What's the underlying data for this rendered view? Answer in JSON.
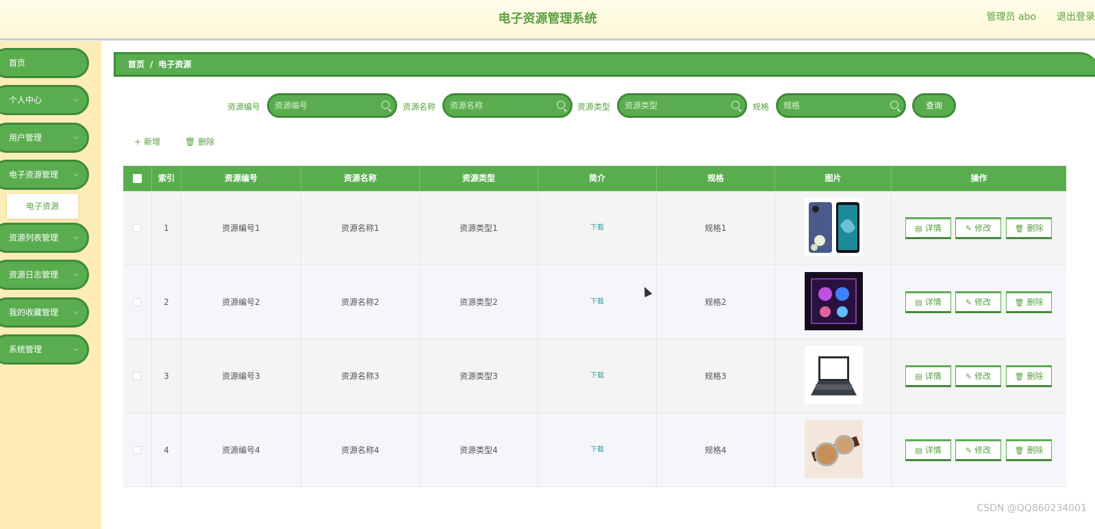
{
  "header": {
    "title": "电子资源管理系统",
    "user": "管理员 abo",
    "logout": "退出登录"
  },
  "sidebar": {
    "items": [
      {
        "label": "首页",
        "has_chevron": false
      },
      {
        "label": "个人中心",
        "has_chevron": true
      },
      {
        "label": "用户管理",
        "has_chevron": true
      },
      {
        "label": "电子资源管理",
        "has_chevron": true
      },
      {
        "label": "资源列表管理",
        "has_chevron": true
      },
      {
        "label": "资源日志管理",
        "has_chevron": true
      },
      {
        "label": "我的收藏管理",
        "has_chevron": true
      },
      {
        "label": "系统管理",
        "has_chevron": true
      }
    ],
    "sub_item": "电子资源",
    "chevron": "⌵"
  },
  "breadcrumb": {
    "home": "首页",
    "sep": "/",
    "current": "电子资源"
  },
  "search": {
    "fields": [
      {
        "label": "资源编号",
        "placeholder": "资源编号"
      },
      {
        "label": "资源名称",
        "placeholder": "资源名称"
      },
      {
        "label": "资源类型",
        "placeholder": "资源类型"
      },
      {
        "label": "规格",
        "placeholder": "规格"
      }
    ],
    "query_label": "查询"
  },
  "toolbar": {
    "add_label": "新增",
    "delete_label": "删除",
    "add_icon": "+",
    "delete_icon": "🗑"
  },
  "table": {
    "headers": [
      "",
      "索引",
      "资源编号",
      "资源名称",
      "资源类型",
      "简介",
      "规格",
      "图片",
      "操作"
    ],
    "rows": [
      {
        "index": "1",
        "code": "资源编号1",
        "name": "资源名称1",
        "type": "资源类型1",
        "intro": "下载",
        "spec": "规格1",
        "image": "phone"
      },
      {
        "index": "2",
        "code": "资源编号2",
        "name": "资源名称2",
        "type": "资源类型2",
        "intro": "下载",
        "spec": "规格2",
        "image": "pc-case"
      },
      {
        "index": "3",
        "code": "资源编号3",
        "name": "资源名称3",
        "type": "资源类型3",
        "intro": "下载",
        "spec": "规格3",
        "image": "laptop"
      },
      {
        "index": "4",
        "code": "资源编号4",
        "name": "资源名称4",
        "type": "资源类型4",
        "intro": "下载",
        "spec": "规格4",
        "image": "watch"
      }
    ],
    "actions": {
      "detail": "详情",
      "edit": "修改",
      "delete": "删除",
      "detail_icon": "▤",
      "edit_icon": "✎",
      "delete_icon": "🗑"
    }
  },
  "watermark": "CSDN @QQ860234001",
  "colors": {
    "green": "#5aad4f",
    "green_dark": "#3f8a37",
    "sidebar_bg": "#fdecb6",
    "header_bg": "#fefde9"
  }
}
